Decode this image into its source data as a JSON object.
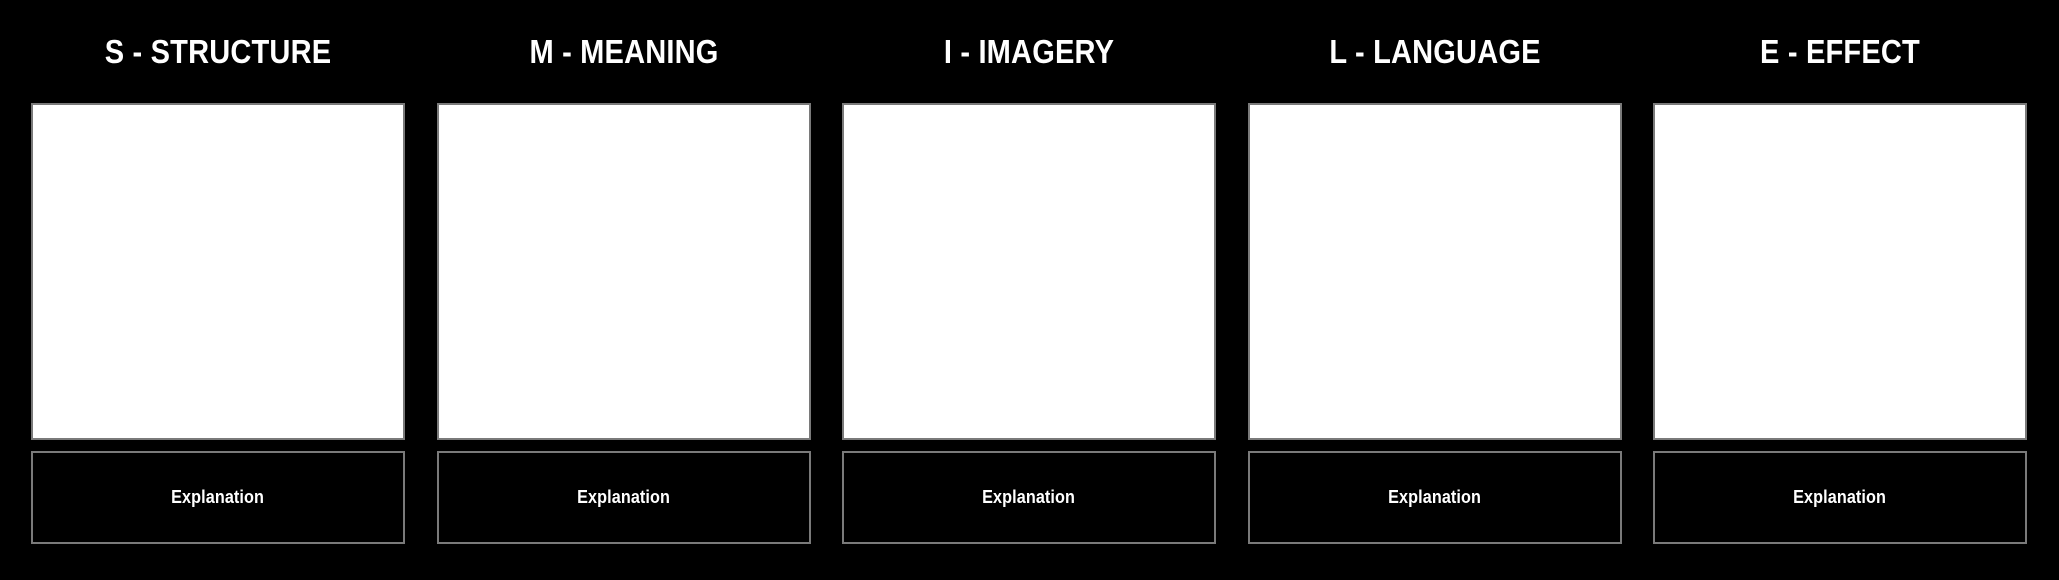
{
  "board": {
    "background_color": "#000000",
    "text_color": "#ffffff",
    "border_color": "#7a7a7a",
    "canvas_color": "#ffffff",
    "columns": [
      {
        "title": "S - STRUCTURE",
        "canvas": "",
        "explanation_label": "Explanation"
      },
      {
        "title": "M - MEANING",
        "canvas": "",
        "explanation_label": "Explanation"
      },
      {
        "title": "I - IMAGERY",
        "canvas": "",
        "explanation_label": "Explanation"
      },
      {
        "title": "L - LANGUAGE",
        "canvas": "",
        "explanation_label": "Explanation"
      },
      {
        "title": "E - EFFECT",
        "canvas": "",
        "explanation_label": "Explanation"
      }
    ]
  }
}
